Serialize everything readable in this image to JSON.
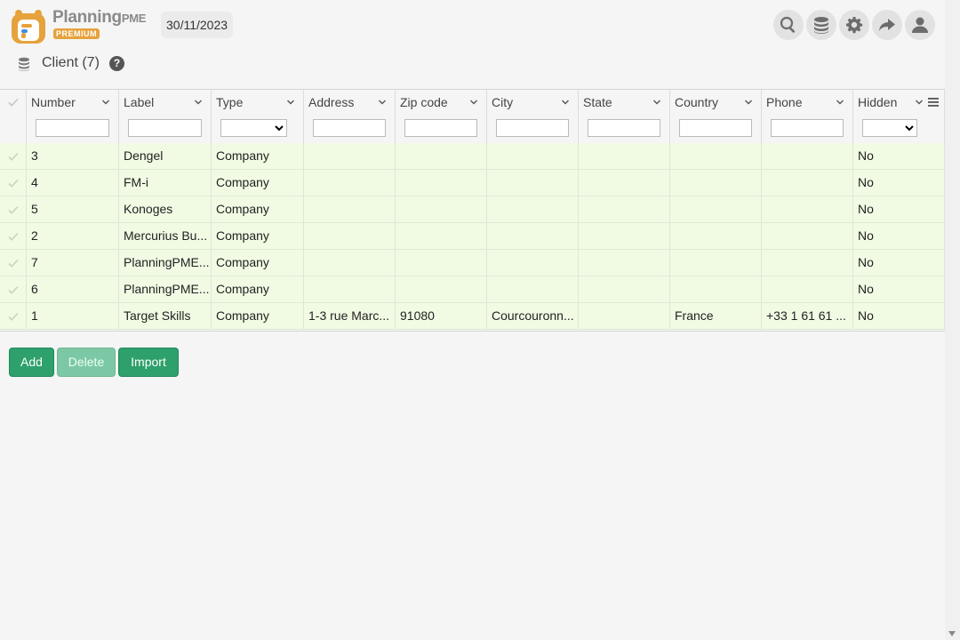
{
  "app": {
    "logo_name": "Planning",
    "logo_suffix": "PME",
    "logo_badge": "PREMIUM",
    "date": "30/11/2023"
  },
  "toolbar": {
    "icons": [
      "search-icon",
      "database-icon",
      "gear-icon",
      "share-icon",
      "user-icon"
    ]
  },
  "page": {
    "title": "Client (7)",
    "help": "?"
  },
  "grid": {
    "columns": [
      {
        "key": "number",
        "label": "Number",
        "filter": "text"
      },
      {
        "key": "label",
        "label": "Label",
        "filter": "text"
      },
      {
        "key": "type",
        "label": "Type",
        "filter": "select"
      },
      {
        "key": "address",
        "label": "Address",
        "filter": "text"
      },
      {
        "key": "zip",
        "label": "Zip code",
        "filter": "text"
      },
      {
        "key": "city",
        "label": "City",
        "filter": "text"
      },
      {
        "key": "state",
        "label": "State",
        "filter": "text"
      },
      {
        "key": "country",
        "label": "Country",
        "filter": "text"
      },
      {
        "key": "phone",
        "label": "Phone",
        "filter": "text"
      },
      {
        "key": "hidden",
        "label": "Hidden",
        "filter": "select"
      }
    ],
    "rows": [
      [
        "3",
        "Dengel",
        "Company",
        "",
        "",
        "",
        "",
        "",
        "",
        "No"
      ],
      [
        "4",
        "FM-i",
        "Company",
        "",
        "",
        "",
        "",
        "",
        "",
        "No"
      ],
      [
        "5",
        "Konoges",
        "Company",
        "",
        "",
        "",
        "",
        "",
        "",
        "No"
      ],
      [
        "2",
        "Mercurius Bu...",
        "Company",
        "",
        "",
        "",
        "",
        "",
        "",
        "No"
      ],
      [
        "7",
        "PlanningPME...",
        "Company",
        "",
        "",
        "",
        "",
        "",
        "",
        "No"
      ],
      [
        "6",
        "PlanningPME...",
        "Company",
        "",
        "",
        "",
        "",
        "",
        "",
        "No"
      ],
      [
        "1",
        "Target Skills",
        "Company",
        "1-3 rue Marc...",
        "91080",
        "Courcouronn...",
        "",
        "France",
        "+33 1 61 61 ...",
        "No"
      ]
    ]
  },
  "actions": {
    "add": "Add",
    "delete": "Delete",
    "import": "Import"
  },
  "colors": {
    "row_bg": "#f1fbe4",
    "button": "#2ea06b",
    "button_disabled": "#7dc8a4",
    "badge": "#e6a23c"
  }
}
